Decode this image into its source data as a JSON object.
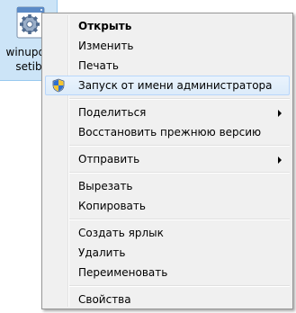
{
  "desktop_icon": {
    "caption_line1": "winupda",
    "caption_line2": "setib"
  },
  "context_menu": {
    "groups": [
      [
        {
          "label": "Открыть",
          "bold": true
        },
        {
          "label": "Изменить"
        },
        {
          "label": "Печать"
        },
        {
          "label": "Запуск от имени администратора",
          "icon": "uac-shield-icon",
          "highlighted": true
        }
      ],
      [
        {
          "label": "Поделиться",
          "submenu": true
        },
        {
          "label": "Восстановить прежнюю версию"
        }
      ],
      [
        {
          "label": "Отправить",
          "submenu": true
        }
      ],
      [
        {
          "label": "Вырезать"
        },
        {
          "label": "Копировать"
        }
      ],
      [
        {
          "label": "Создать ярлык"
        },
        {
          "label": "Удалить"
        },
        {
          "label": "Переименовать"
        }
      ],
      [
        {
          "label": "Свойства"
        }
      ]
    ]
  },
  "colors": {
    "menu_background": "#f0f0f0",
    "highlight": "#dcebfa",
    "highlight_border": "#b8d6fb",
    "icon_selection": "#cce4f7"
  }
}
